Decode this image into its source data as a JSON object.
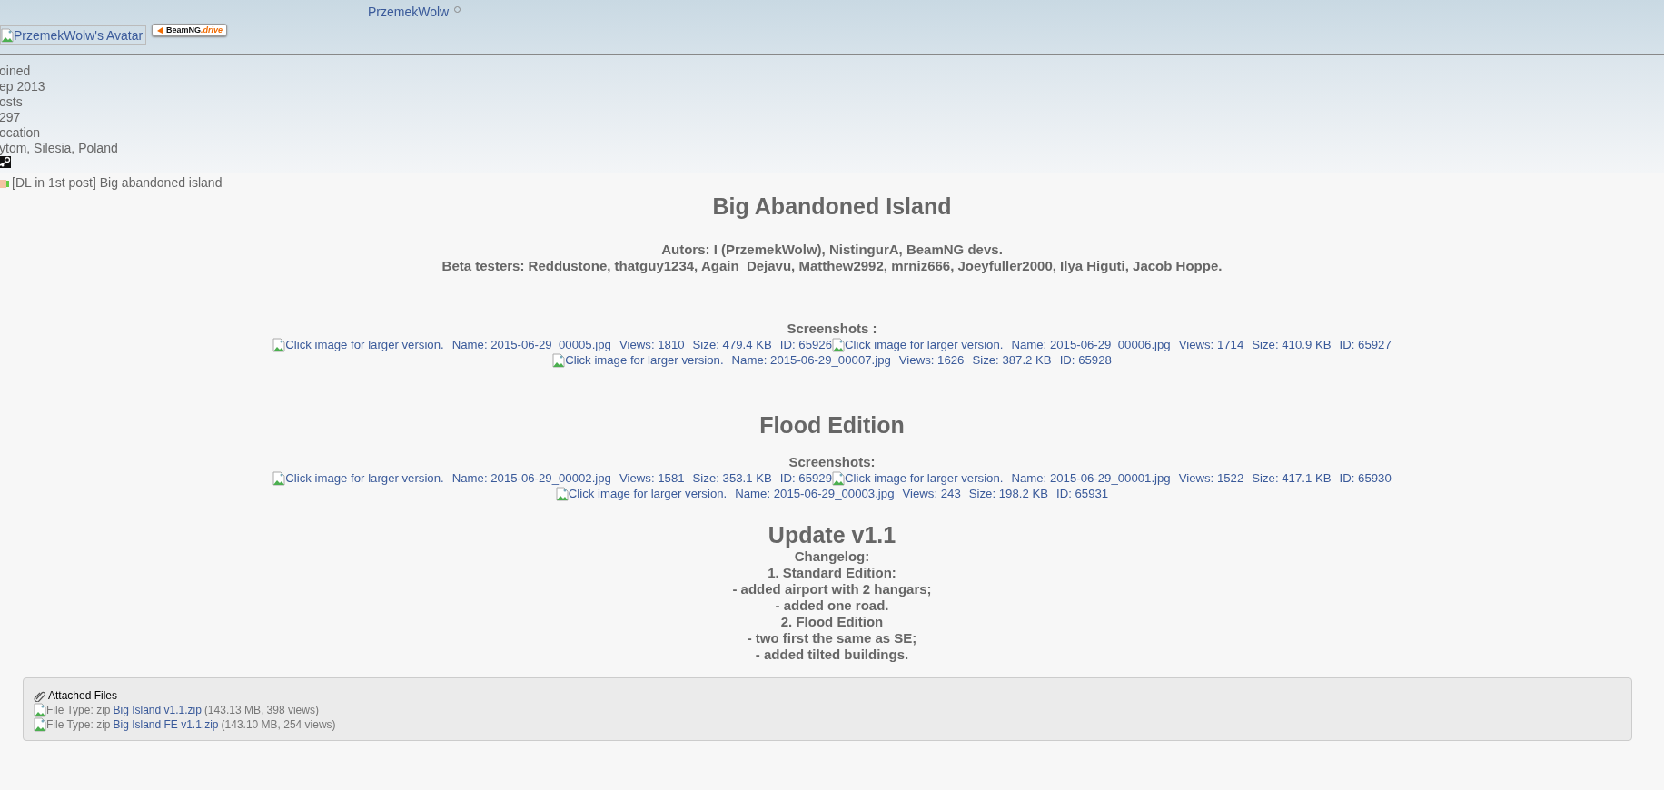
{
  "header": {
    "username": "PrzemekWolw",
    "avatar_alt": "PrzemekWolw's Avatar",
    "badge": {
      "brand": "BeamNG",
      "suffix": ".drive"
    }
  },
  "profile": [
    "oined",
    "ep 2013",
    "osts",
    "297",
    "ocation",
    "ytom, Silesia, Poland"
  ],
  "post": {
    "title": "[DL in 1st post] Big abandoned island",
    "sections": [
      {
        "kind": "heading",
        "text": "Big Abandoned Island"
      },
      {
        "kind": "lines",
        "lines": [
          "Autors: I (PrzemekWolw), NistingurA, BeamNG devs.",
          "Beta testers: Reddustone, thatguy1234, Again_Dejavu, Matthew2992, mrniz666, Joeyfuller2000, Ilya Higuti, Jacob Hoppe."
        ]
      },
      {
        "kind": "gallery",
        "label": "Screenshots :",
        "rows": [
          [
            {
              "alt": "Click image for larger version.",
              "name": "Name: 2015-06-29_00005.jpg",
              "views": "Views: 1810",
              "size": "Size: 479.4 KB",
              "id": "ID: 65926"
            },
            {
              "alt": "Click image for larger version.",
              "name": "Name: 2015-06-29_00006.jpg",
              "views": "Views: 1714",
              "size": "Size: 410.9 KB",
              "id": "ID: 65927"
            }
          ],
          [
            {
              "alt": "Click image for larger version.",
              "name": "Name: 2015-06-29_00007.jpg",
              "views": "Views: 1626",
              "size": "Size: 387.2 KB",
              "id": "ID: 65928"
            }
          ]
        ]
      },
      {
        "kind": "heading",
        "text": "Flood Edition"
      },
      {
        "kind": "gallery",
        "label": "Screenshots:",
        "rows": [
          [
            {
              "alt": "Click image for larger version.",
              "name": "Name: 2015-06-29_00002.jpg",
              "views": "Views: 1581",
              "size": "Size: 353.1 KB",
              "id": "ID: 65929"
            },
            {
              "alt": "Click image for larger version.",
              "name": "Name: 2015-06-29_00001.jpg",
              "views": "Views: 1522",
              "size": "Size: 417.1 KB",
              "id": "ID: 65930"
            }
          ],
          [
            {
              "alt": "Click image for larger version.",
              "name": "Name: 2015-06-29_00003.jpg",
              "views": "Views: 243",
              "size": "Size: 198.2 KB",
              "id": "ID: 65931"
            }
          ]
        ]
      },
      {
        "kind": "heading",
        "text": "Update v1.1"
      },
      {
        "kind": "lines",
        "lines": [
          "Changelog:",
          "1. Standard Edition:",
          "- added airport with 2 hangars;",
          "- added one road.",
          "2. Flood Edition",
          "- two first the same as SE;",
          "- added tilted buildings."
        ]
      }
    ]
  },
  "attachments": {
    "title": "Attached Files",
    "files": [
      {
        "type": "File Type: zip",
        "name": "Big Island v1.1.zip",
        "info": "(143.13 MB, 398 views)"
      },
      {
        "type": "File Type: zip",
        "name": "Big Island FE v1.1.zip",
        "info": "(143.10 MB, 254 views)"
      }
    ]
  }
}
